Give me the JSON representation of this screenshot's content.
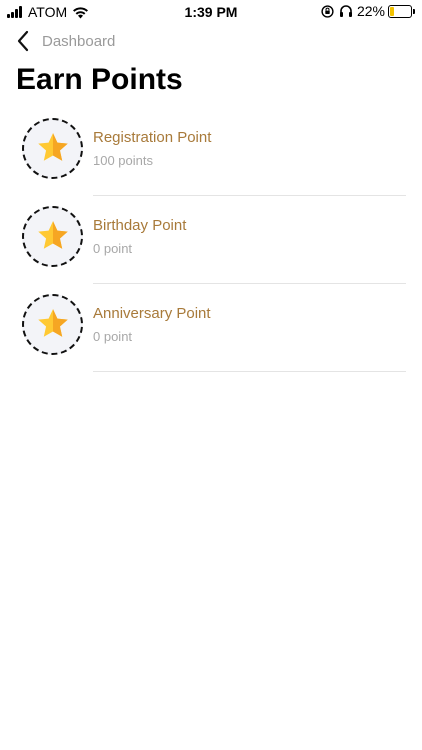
{
  "status_bar": {
    "carrier": "ATOM",
    "time": "1:39 PM",
    "battery_percent": "22%",
    "battery_level": 0.22,
    "battery_color": "#f2c200"
  },
  "nav": {
    "back_label": "Dashboard",
    "back_icon": "chevron-left-icon"
  },
  "page": {
    "title": "Earn Points"
  },
  "points": [
    {
      "name": "Registration Point",
      "value": "100 points",
      "icon": "star-icon"
    },
    {
      "name": "Birthday Point",
      "value": "0 point",
      "icon": "star-icon"
    },
    {
      "name": "Anniversary Point",
      "value": "0 point",
      "icon": "star-icon"
    }
  ],
  "colors": {
    "accent": "#a87a3a",
    "secondary_text": "#a8a8a8",
    "star_light": "#ffc933",
    "star_dark": "#f6a623",
    "badge_bg": "#f3f4f8"
  }
}
